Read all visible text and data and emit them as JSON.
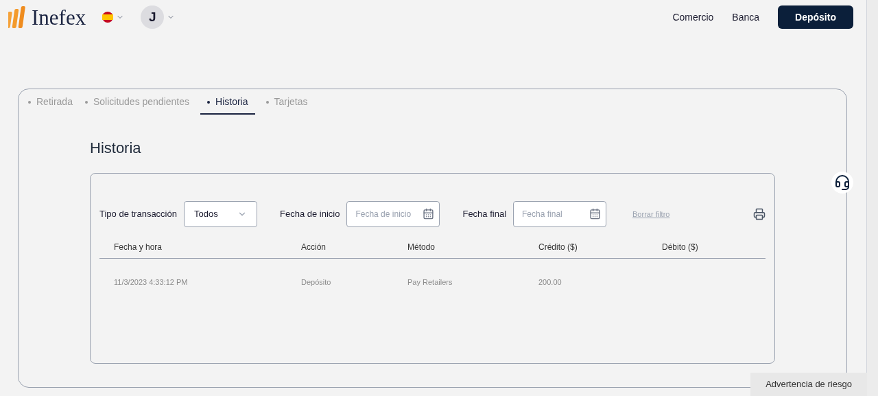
{
  "header": {
    "logo": "Inefex",
    "avatar_initial": "J",
    "nav": [
      "Comercio",
      "Banca"
    ],
    "deposit_button": "Depósito"
  },
  "tabs": [
    {
      "label": "Retirada",
      "selected": false
    },
    {
      "label": "Solicitudes pendientes",
      "selected": false
    },
    {
      "label": "Historia",
      "selected": true
    },
    {
      "label": "Tarjetas",
      "selected": false
    }
  ],
  "page_title": "Historia",
  "filters": {
    "type_label": "Tipo de transacción",
    "type_value": "Todos",
    "start_label": "Fecha de inicio",
    "start_placeholder": "Fecha de inicio",
    "end_label": "Fecha final",
    "end_placeholder": "Fecha final",
    "clear_link": "Borrar filtro"
  },
  "table": {
    "columns": [
      "Fecha y hora",
      "Acción",
      "Método",
      "Crédito ($)",
      "Débito ($)"
    ],
    "rows": [
      [
        "11/3/2023 4:33:12 PM",
        "Depósito",
        "Pay Retailers",
        "200.00",
        ""
      ]
    ]
  },
  "risk_warning": "Advertencia de riesgo"
}
